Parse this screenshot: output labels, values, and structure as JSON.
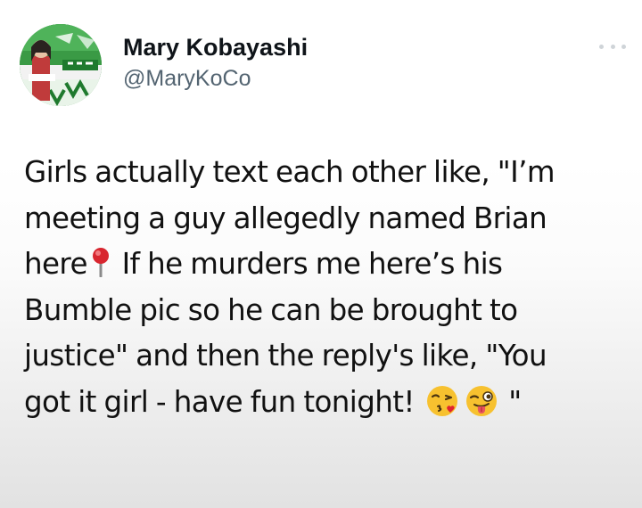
{
  "user": {
    "display_name": "Mary Kobayashi",
    "handle": "@MaryKoCo",
    "avatar_icon": "profile-photo"
  },
  "more_icon": "ellipsis-icon",
  "tweet": {
    "lines": [
      "Girls actually text each other like, \"I’m",
      "meeting a guy allegedly named Brian",
      "here",
      "If he murders me here’s his",
      "Bumble pic so he can be brought to",
      "justice\" and then the reply's like, \"You",
      "got it girl - have fun tonight!",
      "\""
    ],
    "emojis": [
      "round-pushpin",
      "face-blowing-a-kiss",
      "winking-face-with-tongue"
    ]
  },
  "colors": {
    "name": "#0f1419",
    "handle": "#536471",
    "text": "#111111"
  }
}
